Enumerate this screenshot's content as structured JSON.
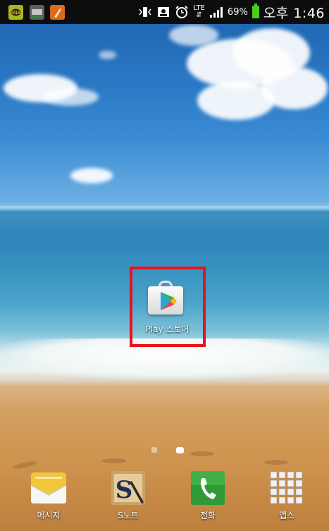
{
  "status_bar": {
    "notification_icons": [
      "kakaotalk-icon",
      "gallery-icon",
      "sweep-icon"
    ],
    "system_icons": [
      "vibrate-icon",
      "photo-icon",
      "alarm-icon",
      "lte-icon",
      "signal-icon"
    ],
    "network": "LTE",
    "battery_percent": "69%",
    "time": "오후 1:46",
    "battery_color": "#4ccc1c"
  },
  "home_screen": {
    "apps": [
      {
        "label": "Play 스토어",
        "icon": "play-store-icon"
      }
    ],
    "highlight_color": "#e8121b",
    "page_indicator": {
      "pages": 2,
      "current": 2
    }
  },
  "dock": {
    "items": [
      {
        "label": "메시지",
        "icon": "message-icon"
      },
      {
        "label": "S노트",
        "icon": "s-note-icon"
      },
      {
        "label": "전화",
        "icon": "phone-icon"
      },
      {
        "label": "앱스",
        "icon": "apps-grid-icon"
      }
    ]
  }
}
